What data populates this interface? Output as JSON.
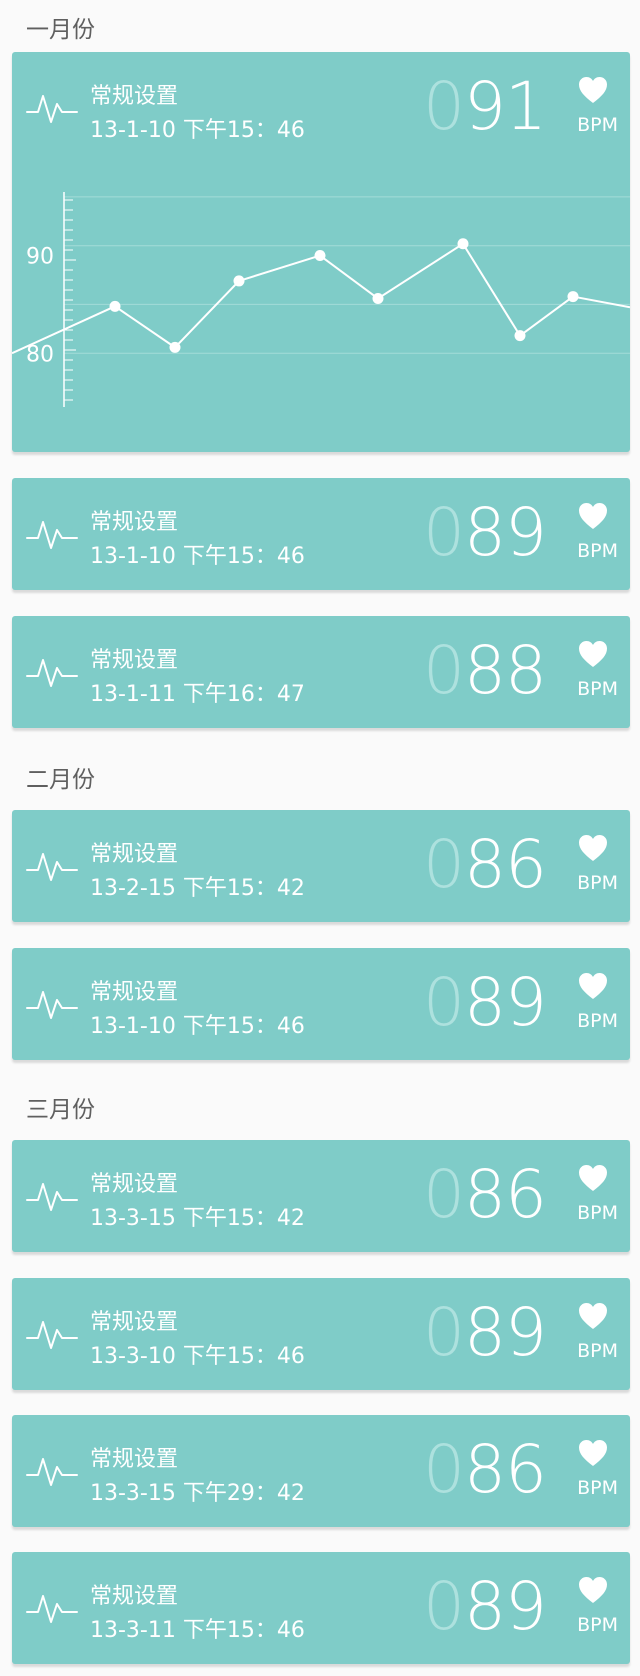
{
  "sections": [
    {
      "title": "一月份",
      "records": [
        {
          "title": "常规设置",
          "time": "13-1-10 下午15：46",
          "bpm_prefix": "0",
          "bpm": "91",
          "bpm_label": "BPM"
        },
        {
          "title": "常规设置",
          "time": "13-1-10 下午15：46",
          "bpm_prefix": "0",
          "bpm": "89",
          "bpm_label": "BPM"
        },
        {
          "title": "常规设置",
          "time": "13-1-11 下午16：47",
          "bpm_prefix": "0",
          "bpm": "88",
          "bpm_label": "BPM"
        }
      ]
    },
    {
      "title": "二月份",
      "records": [
        {
          "title": "常规设置",
          "time": "13-2-15 下午15：42",
          "bpm_prefix": "0",
          "bpm": "86",
          "bpm_label": "BPM"
        },
        {
          "title": "常规设置",
          "time": "13-1-10 下午15：46",
          "bpm_prefix": "0",
          "bpm": "89",
          "bpm_label": "BPM"
        }
      ]
    },
    {
      "title": "三月份",
      "records": [
        {
          "title": "常规设置",
          "time": "13-3-15 下午15：42",
          "bpm_prefix": "0",
          "bpm": "86",
          "bpm_label": "BPM"
        },
        {
          "title": "常规设置",
          "time": "13-3-10 下午15：46",
          "bpm_prefix": "0",
          "bpm": "89",
          "bpm_label": "BPM"
        },
        {
          "title": "常规设置",
          "time": "13-3-15 下午29：42",
          "bpm_prefix": "0",
          "bpm": "86",
          "bpm_label": "BPM"
        },
        {
          "title": "常规设置",
          "time": "13-3-11 下午15：46",
          "bpm_prefix": "0",
          "bpm": "89",
          "bpm_label": "BPM"
        }
      ]
    }
  ],
  "chart_data": {
    "type": "line",
    "title": "",
    "xlabel": "",
    "ylabel": "",
    "yticks": [
      "90",
      "80"
    ],
    "ylim": [
      74.5,
      96.5
    ],
    "grid": true,
    "series": [
      {
        "values": [
          80.0,
          84.8,
          80.6,
          87.4,
          90.0,
          85.6,
          91.2,
          81.8,
          85.8,
          84.7
        ]
      }
    ]
  },
  "colors": {
    "card": "#7fccc8",
    "text": "#ffffff",
    "dim_digit": "#ade1de",
    "section_title": "#5f5f5f",
    "page_bg": "#fafafa"
  },
  "icons": {
    "pulse": "pulse-icon",
    "heart": "heart-icon"
  }
}
